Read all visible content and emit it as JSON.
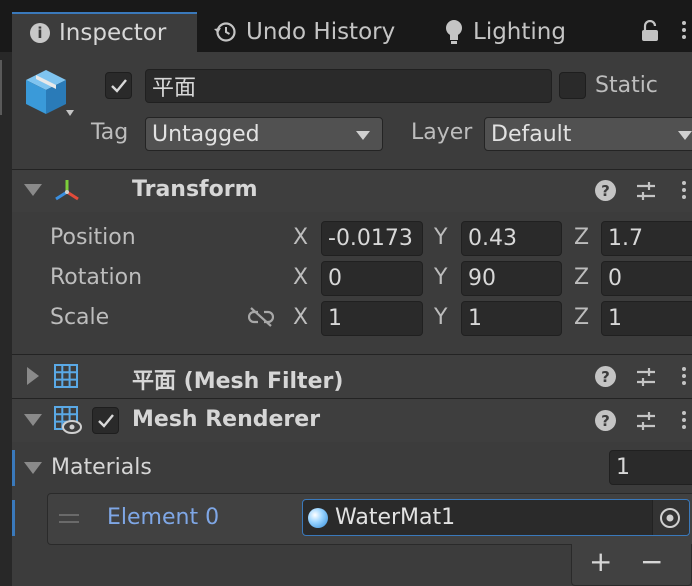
{
  "tabs": [
    {
      "label": "Inspector",
      "icon": "info-icon"
    },
    {
      "label": "Undo History",
      "icon": "history-icon"
    },
    {
      "label": "Lighting",
      "icon": "lightbulb-icon"
    }
  ],
  "header": {
    "object_name": "平面",
    "active": true,
    "static_label": "Static",
    "tag_label": "Tag",
    "tag_value": "Untagged",
    "layer_label": "Layer",
    "layer_value": "Default"
  },
  "transform": {
    "title": "Transform",
    "rows": [
      {
        "label": "Position",
        "x": "-0.0173",
        "y": "0.43",
        "z": "1.7"
      },
      {
        "label": "Rotation",
        "x": "0",
        "y": "90",
        "z": "0"
      },
      {
        "label": "Scale",
        "x": "1",
        "y": "1",
        "z": "1"
      }
    ],
    "axis_labels": [
      "X",
      "Y",
      "Z"
    ]
  },
  "mesh_filter": {
    "title": "平面 (Mesh Filter)"
  },
  "mesh_renderer": {
    "title": "Mesh Renderer",
    "enabled": true
  },
  "materials": {
    "label": "Materials",
    "count": "1",
    "elements": [
      {
        "label": "Element 0",
        "value": "WaterMat1"
      }
    ],
    "add_label": "+",
    "remove_label": "−"
  },
  "colors": {
    "accent": "#3a79bb",
    "element_label": "#7fa7e6",
    "background": "#383838",
    "tab_bar": "#191919"
  }
}
